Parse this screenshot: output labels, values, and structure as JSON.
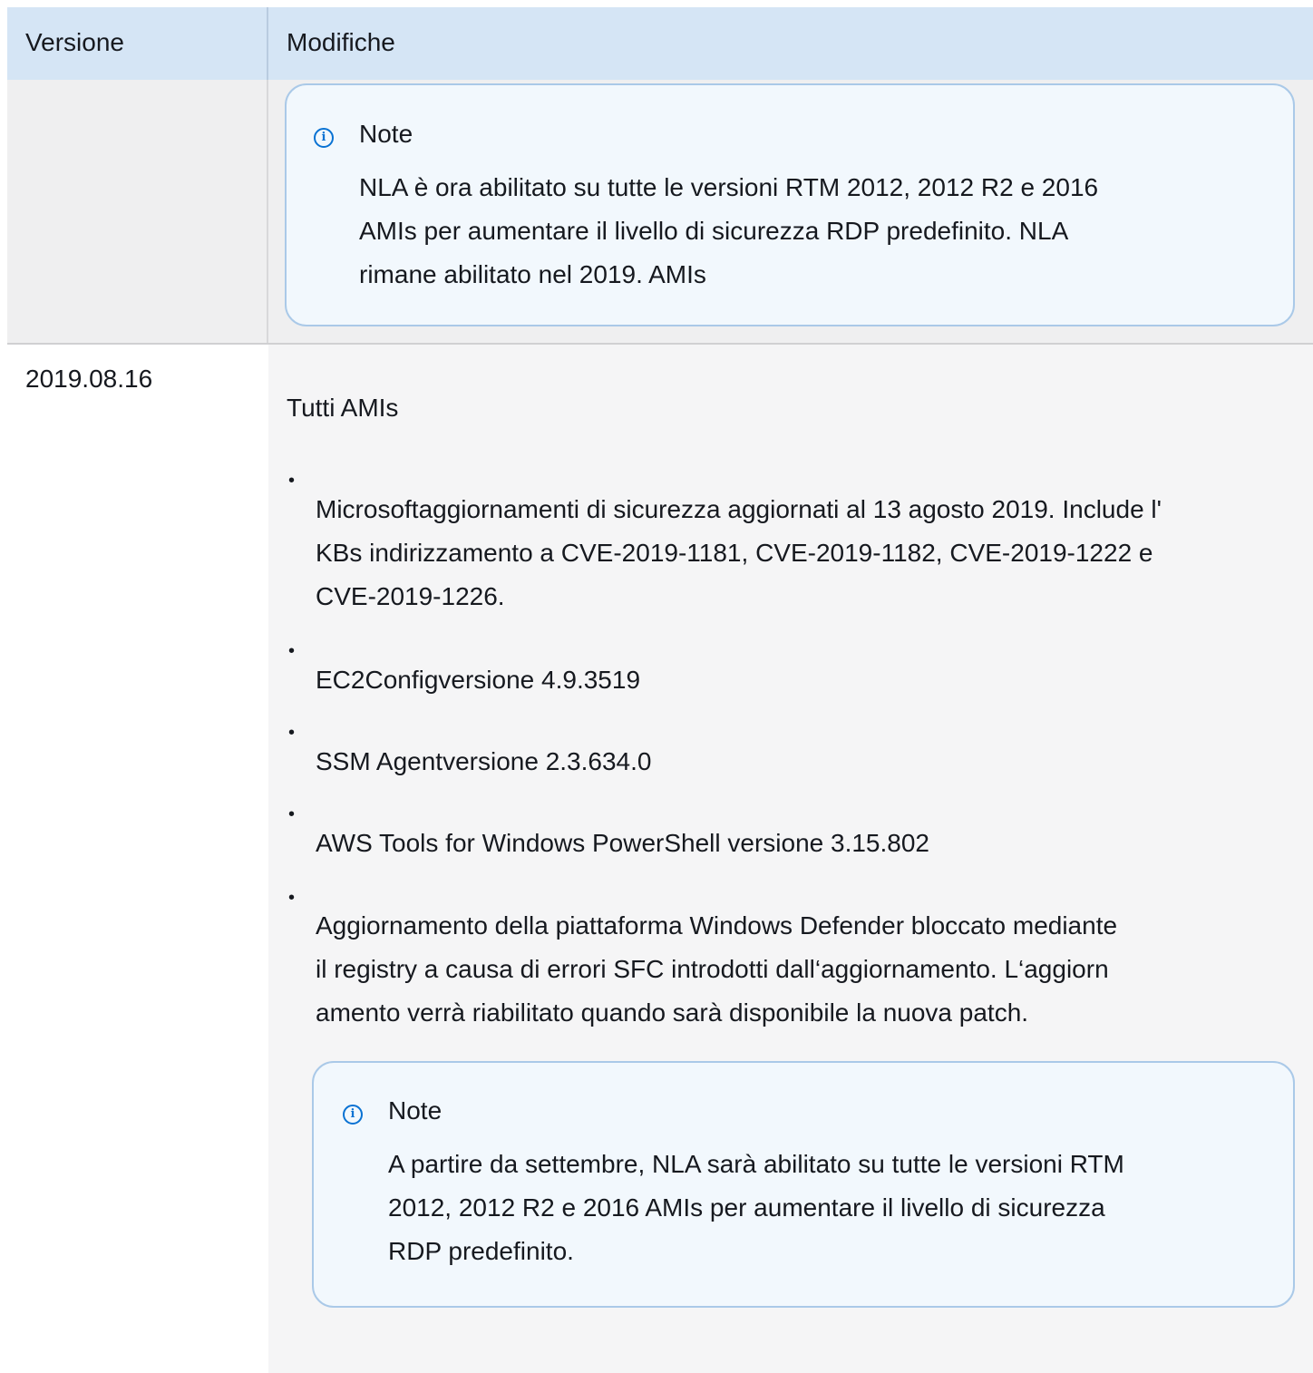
{
  "table": {
    "headers": {
      "version": "Versione",
      "changes": "Modifiche"
    },
    "row1": {
      "note": {
        "title": "Note",
        "lines": [
          "NLA è ora abilitato su tutte le versioni RTM 2012, 2012 R2 e 2016",
          "AMIs per aumentare il livello di sicurezza RDP predefinito. NLA",
          "rimane abilitato nel 2019. AMIs"
        ]
      }
    },
    "row2": {
      "version": "2019.08.16",
      "intro": "Tutti AMIs",
      "bullet": "•",
      "items": [
        {
          "lines": [
            "Microsoftaggiornamenti di sicurezza aggiornati al 13 agosto 2019. Include l'",
            "KBs indirizzamento a CVE-2019-1181, CVE-2019-1182, CVE-2019-1222 e",
            "CVE-2019-1226."
          ]
        },
        {
          "lines": [
            "EC2Configversione 4.9.3519"
          ]
        },
        {
          "lines": [
            "SSM Agentversione 2.3.634.0"
          ]
        },
        {
          "lines": [
            "AWS Tools for Windows PowerShell versione 3.15.802"
          ]
        },
        {
          "lines": [
            "Aggiornamento della piattaforma Windows Defender bloccato mediante",
            "il registry a causa di errori SFC introdotti dall‘aggiornamento. L‘aggiorn",
            "amento verrà riabilitato quando sarà disponibile la nuova patch."
          ]
        }
      ],
      "note": {
        "title": "Note",
        "lines": [
          "A partire da settembre, NLA sarà abilitato su tutte le versioni RTM",
          "2012, 2012 R2 e 2016 AMIs per aumentare il livello di sicurezza",
          "RDP predefinito."
        ]
      }
    }
  },
  "colors": {
    "header_bg": "#d5e5f5",
    "note_border": "#aac9e8",
    "note_bg": "#f2f8fd",
    "info_icon": "#0972d3",
    "shaded_row_bg": "#efeff0"
  },
  "icons": {
    "note": "info-circle-icon"
  }
}
